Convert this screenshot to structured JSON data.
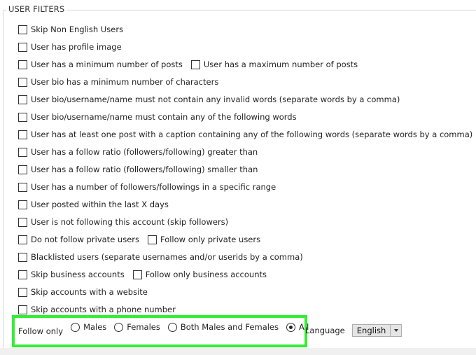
{
  "group": {
    "title": "USER FILTERS"
  },
  "rows": [
    {
      "items": [
        {
          "label": "Skip Non English Users",
          "checked": false
        }
      ]
    },
    {
      "items": [
        {
          "label": "User has profile image",
          "checked": false
        }
      ]
    },
    {
      "items": [
        {
          "label": "User has a minimum number of posts",
          "checked": false
        },
        {
          "label": "User has a maximum number of posts",
          "checked": false
        }
      ]
    },
    {
      "items": [
        {
          "label": "User bio has a minimum number of characters",
          "checked": false
        }
      ]
    },
    {
      "items": [
        {
          "label": "User bio/username/name must not contain any invalid words (separate words by a comma)",
          "checked": false
        }
      ]
    },
    {
      "items": [
        {
          "label": "User bio/username/name must contain any of the following words",
          "checked": false
        }
      ]
    },
    {
      "items": [
        {
          "label": "User has at least one post with a caption containing any of the following words (separate words by a comma)",
          "checked": false
        }
      ]
    },
    {
      "items": [
        {
          "label": "User has a follow ratio (followers/following) greater than",
          "checked": false
        }
      ]
    },
    {
      "items": [
        {
          "label": "User has a follow ratio (followers/following) smaller than",
          "checked": false
        }
      ]
    },
    {
      "items": [
        {
          "label": "User has a number of followers/followings in a specific range",
          "checked": false
        }
      ]
    },
    {
      "items": [
        {
          "label": "User posted within the last X days",
          "checked": false
        }
      ]
    },
    {
      "items": [
        {
          "label": "User is not following this account (skip followers)",
          "checked": false
        }
      ]
    },
    {
      "items": [
        {
          "label": "Do not follow private users",
          "checked": false
        },
        {
          "label": "Follow only private users",
          "checked": false
        }
      ]
    },
    {
      "items": [
        {
          "label": "Blacklisted users (separate usernames and/or userids by a comma)",
          "checked": false
        }
      ]
    },
    {
      "items": [
        {
          "label": "Skip business accounts",
          "checked": false
        },
        {
          "label": "Follow only business accounts",
          "checked": false
        }
      ]
    },
    {
      "items": [
        {
          "label": "Skip accounts with a website",
          "checked": false
        }
      ]
    },
    {
      "items": [
        {
          "label": "Skip accounts with a phone number",
          "checked": false
        }
      ]
    }
  ],
  "follow_only": {
    "label": "Follow only",
    "options": [
      {
        "label": "Males",
        "selected": false
      },
      {
        "label": "Females",
        "selected": false
      },
      {
        "label": "Both Males and Females",
        "selected": false
      },
      {
        "label": "All",
        "selected": true
      }
    ]
  },
  "language": {
    "label": "Language",
    "selected": "English"
  },
  "colors": {
    "highlight": "#33ee33",
    "select_bg": "#e5e5e5"
  }
}
